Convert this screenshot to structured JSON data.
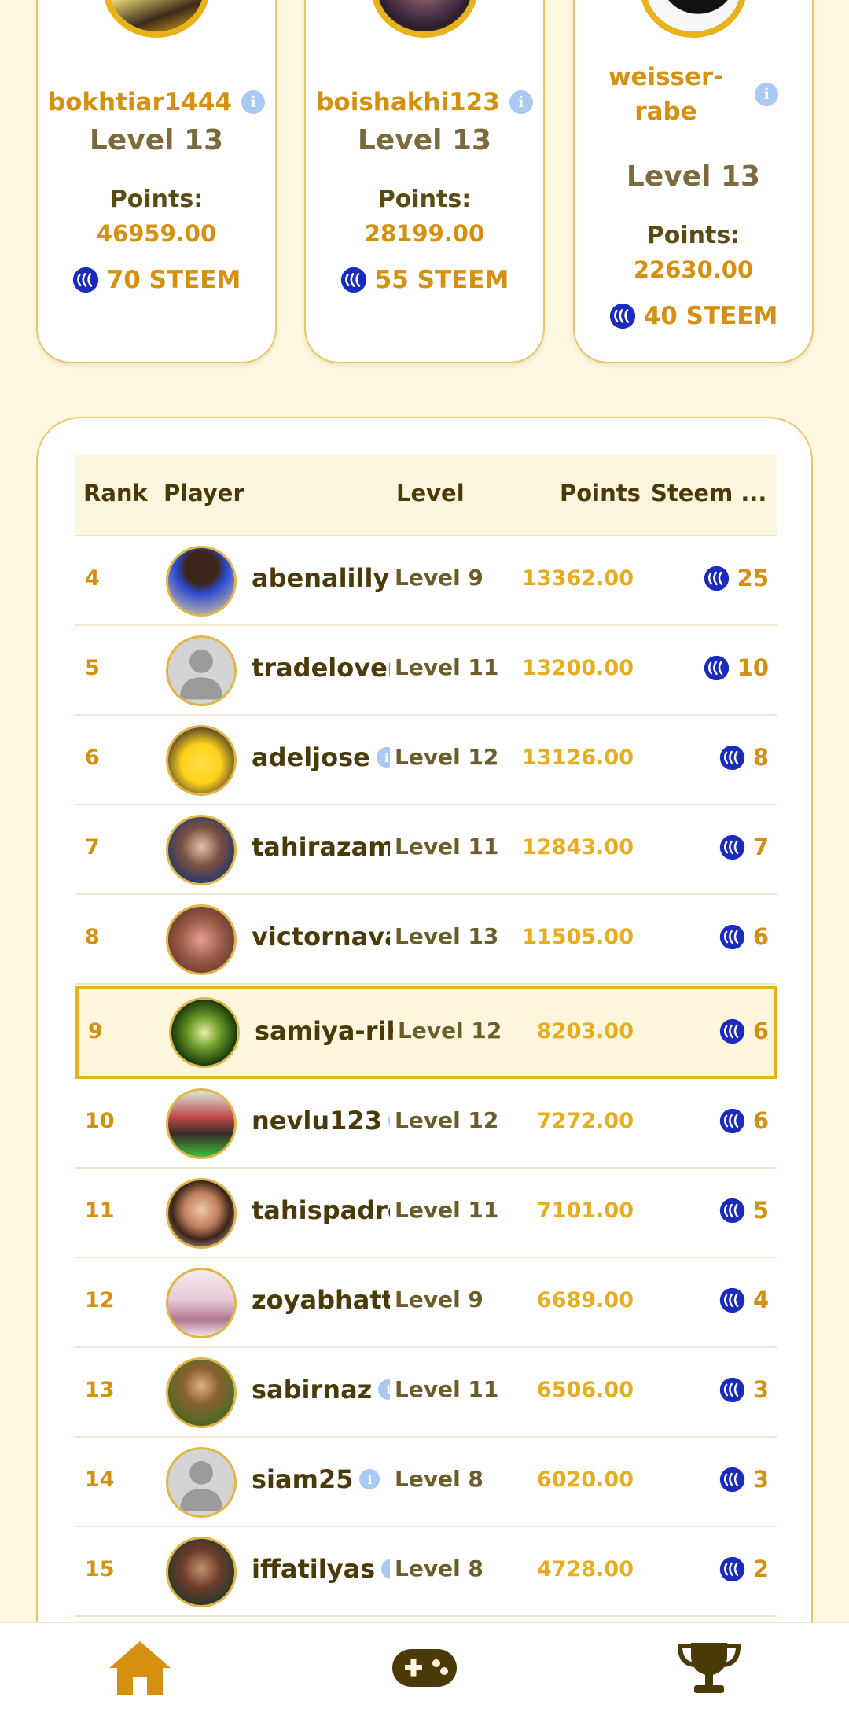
{
  "podium": [
    {
      "username": "bokhtiar1444",
      "level": "Level 13",
      "points_label": "Points:",
      "points": "46959.00",
      "steem": "70 STEEM"
    },
    {
      "username": "boishakhi123",
      "level": "Level 13",
      "points_label": "Points:",
      "points": "28199.00",
      "steem": "55 STEEM"
    },
    {
      "username_line1": "weisser-",
      "username_line2": "rabe",
      "level": "Level 13",
      "points_label": "Points:",
      "points": "22630.00",
      "steem": "40 STEEM"
    }
  ],
  "table": {
    "headers": {
      "rank": "Rank",
      "player": "Player",
      "level": "Level",
      "points": "Points",
      "steem": "Steem ..."
    },
    "rows": [
      {
        "rank": "4",
        "player": "abenalillyf",
        "level": "Level 9",
        "points": "13362.00",
        "steem": "25"
      },
      {
        "rank": "5",
        "player": "tradelover",
        "level": "Level 11",
        "points": "13200.00",
        "steem": "10"
      },
      {
        "rank": "6",
        "player": "adeljose",
        "level": "Level 12",
        "points": "13126.00",
        "steem": "8"
      },
      {
        "rank": "7",
        "player": "tahirazam",
        "level": "Level 11",
        "points": "12843.00",
        "steem": "7"
      },
      {
        "rank": "8",
        "player": "victornava",
        "level": "Level 13",
        "points": "11505.00",
        "steem": "6"
      },
      {
        "rank": "9",
        "player": "samiya-rih",
        "level": "Level 12",
        "points": "8203.00",
        "steem": "6"
      },
      {
        "rank": "10",
        "player": "nevlu123",
        "level": "Level 12",
        "points": "7272.00",
        "steem": "6"
      },
      {
        "rank": "11",
        "player": "tahispadro",
        "level": "Level 11",
        "points": "7101.00",
        "steem": "5"
      },
      {
        "rank": "12",
        "player": "zoyabhatti",
        "level": "Level 9",
        "points": "6689.00",
        "steem": "4"
      },
      {
        "rank": "13",
        "player": "sabirnaz",
        "level": "Level 11",
        "points": "6506.00",
        "steem": "3"
      },
      {
        "rank": "14",
        "player": "siam25",
        "level": "Level 8",
        "points": "6020.00",
        "steem": "3"
      },
      {
        "rank": "15",
        "player": "iffatilyas",
        "level": "Level 8",
        "points": "4728.00",
        "steem": "2"
      }
    ]
  },
  "colors": {
    "accent": "#e9b21a",
    "gold_text": "#d4900e",
    "steem_blue": "#1a2bbd",
    "background": "#fdf7e2"
  },
  "nav": {
    "items": [
      "home-icon",
      "gamepad-icon",
      "trophy-icon"
    ]
  }
}
